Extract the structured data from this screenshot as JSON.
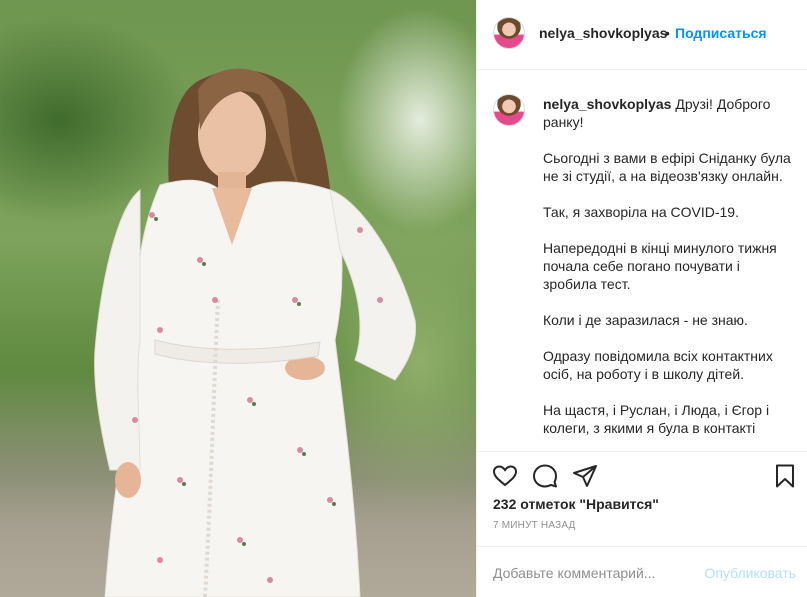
{
  "post": {
    "username": "nelya_shovkoplyas",
    "dot": "•",
    "follow_label": "Подписаться",
    "caption_lines": [
      "Друзі! Доброго ранку!",
      "Сьогодні з вами в ефірі Сніданку була не зі студії, а на відеозв'язку онлайн.",
      "Так, я захворіла на COVID-19.",
      "Напередодні в кінці минулого тижня почала себе погано почувати і зробила тест.",
      "Коли і де заразилася - не знаю.",
      "Одразу повідомила всіх контактних осіб, на роботу і в школу дітей.",
      "На щастя, і Руслан, і Люда, і Єгор і колеги, з якими я була в контакті"
    ],
    "likes": "232 отметок \"Нравится\"",
    "time": "7 минут назад"
  },
  "comment": {
    "placeholder": "Добавьте комментарий...",
    "publish_label": "Опубликовать"
  },
  "icons": {
    "like": "heart-icon",
    "comment": "comment-icon",
    "share": "paper-plane-icon",
    "save": "bookmark-icon"
  },
  "colors": {
    "accent": "#0095f6",
    "publish_disabled": "#b2dffc",
    "muted": "#8e8e8e",
    "border": "#efefef"
  }
}
